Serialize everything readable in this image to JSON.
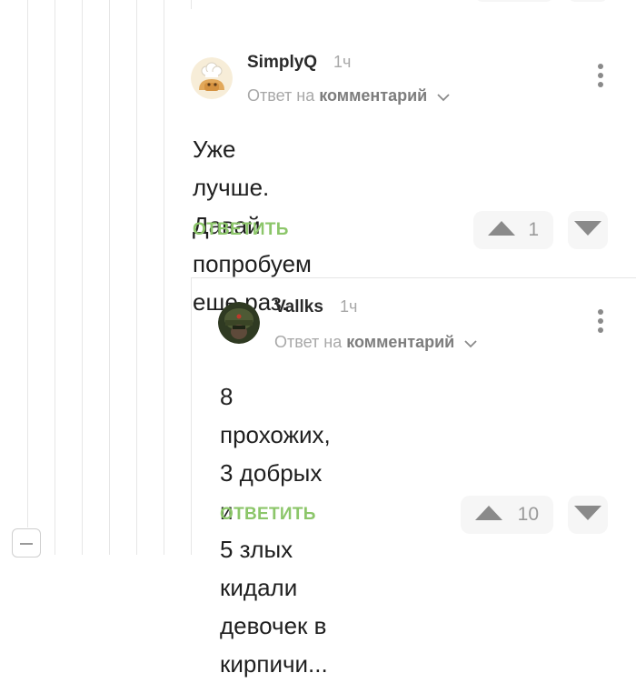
{
  "comments": [
    {
      "author": "SimplyQ",
      "time": "1ч",
      "reply_prefix": "Ответ на",
      "reply_target": "комментарий",
      "text_lines": [
        "Уже лучше. Давай попробуем",
        "еще раз."
      ],
      "reply_label": "ОТВЕТИТЬ",
      "rating": "1"
    },
    {
      "author": "Vallks",
      "time": "1ч",
      "reply_prefix": "Ответ на",
      "reply_target": "комментарий",
      "text_lines": [
        "8 прохожих, 3 добрых и",
        "5 злых кидали девочек в",
        "кирпичи..."
      ],
      "reply_label": "ОТВЕТИТЬ",
      "rating": "10"
    }
  ],
  "colors": {
    "accent_green": "#8cc66a",
    "muted_text": "#a8a8a8",
    "vote_bg": "#f6f6f6"
  }
}
